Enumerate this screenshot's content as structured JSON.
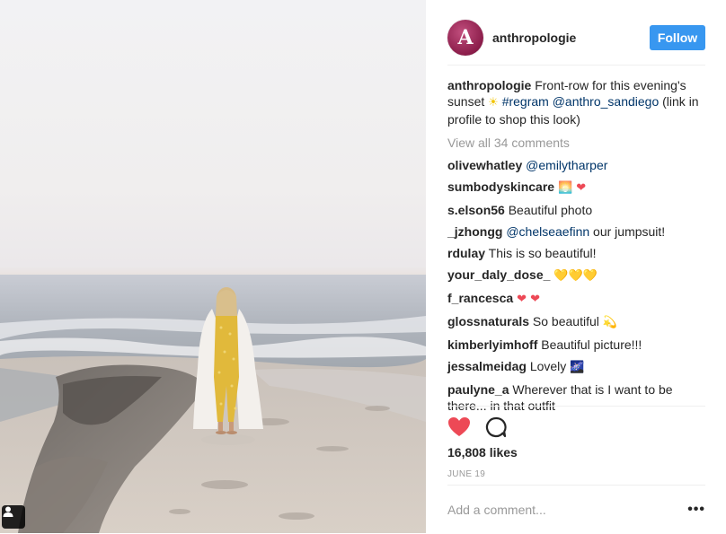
{
  "post": {
    "username": "anthropologie",
    "avatar_letter": "A",
    "follow_label": "Follow",
    "caption": {
      "username": "anthropologie",
      "text_before": "Front-row for this evening's sunset",
      "sun_emoji": "☀",
      "hashtag": "#regram",
      "mention": "@anthro_sandiego",
      "text_after": "(link in profile to shop this look)"
    },
    "view_all_comments": "View all 34 comments",
    "comments": [
      {
        "user": "olivewhatley",
        "mention": "@emilytharper",
        "text": ""
      },
      {
        "user": "sumbodyskincare",
        "text": "",
        "emoji": "🌅 ❤"
      },
      {
        "user": "s.elson56",
        "text": "Beautiful photo"
      },
      {
        "user": "_jzhongg",
        "mention": "@chelseaefinn",
        "text": "our jumpsuit!"
      },
      {
        "user": "rdulay",
        "text": "This is so beautiful!"
      },
      {
        "user": "your_daly_dose_",
        "text": "",
        "emoji": "💛💛💛"
      },
      {
        "user": "f_rancesca",
        "text": "",
        "emoji": "❤ ❤"
      },
      {
        "user": "glossnaturals",
        "text": "So beautiful",
        "emoji": "💫"
      },
      {
        "user": "kimberlyimhoff",
        "text": "Beautiful picture!!!"
      },
      {
        "user": "jessalmeidag",
        "text": "Lovely",
        "emoji": "🌌"
      },
      {
        "user": "paulyne_a",
        "text": "Wherever that is I want to be there... in that outfit"
      }
    ],
    "likes": "16,808 likes",
    "date": "JUNE 19",
    "add_comment_placeholder": "Add a comment...",
    "more_options": "•••"
  },
  "icons": {
    "like": "heart-icon",
    "comment": "comment-bubble-icon",
    "tag": "user-tag-icon",
    "more": "more-options-icon"
  },
  "colors": {
    "follow_button": "#3897f0",
    "like_red": "#ed4956",
    "mention_blue": "#003569",
    "muted_gray": "#999999"
  }
}
